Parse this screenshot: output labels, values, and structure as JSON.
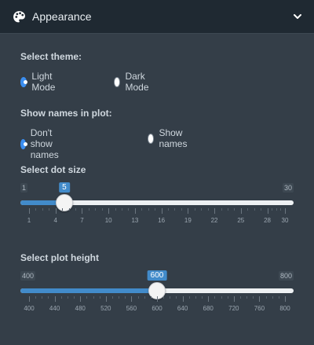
{
  "header": {
    "title": "Appearance",
    "icon": "palette-icon",
    "toggle_icon": "chevron-down-icon"
  },
  "theme": {
    "label": "Select theme:",
    "options": [
      "Light Mode",
      "Dark Mode"
    ],
    "selected": "Light Mode"
  },
  "names": {
    "label": "Show names in plot:",
    "options": [
      "Don't show names",
      "Show names"
    ],
    "selected": "Don't show names"
  },
  "dot_size": {
    "label": "Select dot size",
    "min": "1",
    "max": "30",
    "value": "5",
    "ticks": [
      "1",
      "4",
      "7",
      "10",
      "13",
      "16",
      "19",
      "22",
      "25",
      "28",
      "30"
    ]
  },
  "plot_height": {
    "label": "Select plot height",
    "min": "400",
    "max": "800",
    "value": "600",
    "ticks": [
      "400",
      "440",
      "480",
      "520",
      "560",
      "600",
      "640",
      "680",
      "720",
      "760",
      "800"
    ]
  },
  "colors": {
    "accent": "#428bca",
    "panel_bg": "#343e48",
    "header_bg": "#1f2932"
  }
}
